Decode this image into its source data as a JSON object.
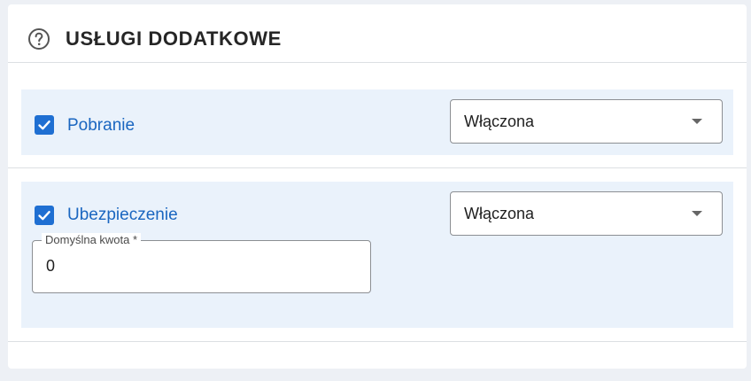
{
  "section": {
    "title": "USŁUGI DODATKOWE",
    "help_icon": "question-circle-icon"
  },
  "services": [
    {
      "label": "Pobranie",
      "checked": true,
      "select_value": "Włączona"
    },
    {
      "label": "Ubezpieczenie",
      "checked": true,
      "select_value": "Włączona",
      "amount_label": "Domyślna kwota *",
      "amount_value": "0"
    }
  ],
  "colors": {
    "accent": "#1f6fd2",
    "label_blue": "#1a66c0",
    "row_background": "#eaf2fb"
  }
}
